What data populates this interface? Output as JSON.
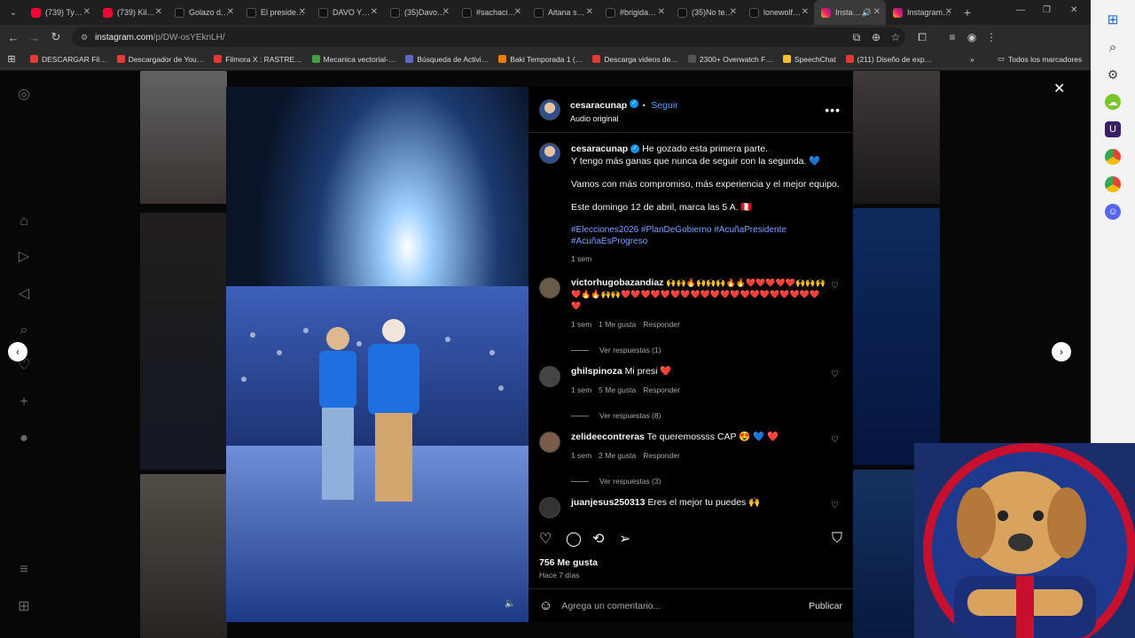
{
  "tabs": [
    {
      "title": "(739) Ty…",
      "fav": "yt"
    },
    {
      "title": "(739) Kil…",
      "fav": "yt"
    },
    {
      "title": "Golazo d…",
      "fav": "tt"
    },
    {
      "title": "El preside…",
      "fav": "tt"
    },
    {
      "title": "DAVO Y…",
      "fav": "tt"
    },
    {
      "title": "(35)Davo…",
      "fav": "tt"
    },
    {
      "title": "#sachaci…",
      "fav": "tt"
    },
    {
      "title": "Aitana s…",
      "fav": "tt"
    },
    {
      "title": "#brigida…",
      "fav": "tt"
    },
    {
      "title": "(35)No te…",
      "fav": "tt"
    },
    {
      "title": "lonewolf…",
      "fav": "tt"
    },
    {
      "title": "Insta…",
      "fav": "ig",
      "active": true
    },
    {
      "title": "Instagram…",
      "fav": "ig"
    }
  ],
  "address": {
    "host": "instagram.com",
    "path": "/p/DW-osYEknLH/"
  },
  "bookmarks": [
    {
      "label": "DESCARGAR Fil…",
      "color": "#e53935"
    },
    {
      "label": "Descargador de You…",
      "color": "#e53935"
    },
    {
      "label": "Filmora X : RASTRE…",
      "color": "#e53935"
    },
    {
      "label": "Mecanica vectorial-…",
      "color": "#43a047"
    },
    {
      "label": "Búsqueda de Activi…",
      "color": "#5c6bc0"
    },
    {
      "label": "Baki Temporada 1 (…",
      "color": "#f57c00"
    },
    {
      "label": "Descarga videos de…",
      "color": "#e53935"
    },
    {
      "label": "2300+ Overwatch F…",
      "color": "#555555"
    },
    {
      "label": "SpeechChat",
      "color": "#fbc02d"
    },
    {
      "label": "(211) Diseño de exp…",
      "color": "#e53935"
    }
  ],
  "bookmarks_all": "Todos los marcadores",
  "post": {
    "username": "cesaracunap",
    "follow": "Seguir",
    "audio": "Audio original",
    "caption": {
      "username": "cesaracunap",
      "lines": [
        "He gozado esta primera parte.",
        "Y tengo más ganas que nunca de seguir con la segunda. 💙"
      ],
      "p2": "Vamos con más compromiso, más experiencia y el mejor equipo.",
      "p3": "Este domingo 12 de abril, marca las 5 A. 🇵🇪",
      "hashtags": "#Elecciones2026 #PlanDeGobierno #AcuñaPresidente #AcuñaEsProgreso",
      "time": "1 sem"
    },
    "comments": [
      {
        "user": "victorhugobazandiaz",
        "text": "🙌🙌🔥🙌🙌🙌🔥🔥❤️❤️❤️❤️❤️🙌🙌🙌❤️🔥🔥🙌🙌❤️❤️❤️❤️❤️❤️❤️❤️❤️❤️❤️❤️❤️❤️❤️❤️❤️❤️❤️❤️❤️",
        "time": "1 sem",
        "likes": "1 Me gusta",
        "reply": "Responder",
        "replies": "Ver respuestas (1)"
      },
      {
        "user": "ghilspinoza",
        "text": "Mi presi ❤️",
        "time": "1 sem",
        "likes": "5 Me gusta",
        "reply": "Responder",
        "replies": "Ver respuestas (8)"
      },
      {
        "user": "zelideecontreras",
        "text": "Te queremossss CAP 😍 💙 ❤️",
        "time": "1 sem",
        "likes": "2 Me gusta",
        "reply": "Responder",
        "replies": "Ver respuestas (3)"
      },
      {
        "user": "juanjesus250313",
        "text": "Eres el mejor tu puedes 🙌",
        "time": "",
        "likes": "",
        "reply": "",
        "replies": ""
      }
    ],
    "likes": "756 Me gusta",
    "ago": "Hace 7 días",
    "comment_placeholder": "Agrega un comentario...",
    "publish": "Publicar"
  }
}
